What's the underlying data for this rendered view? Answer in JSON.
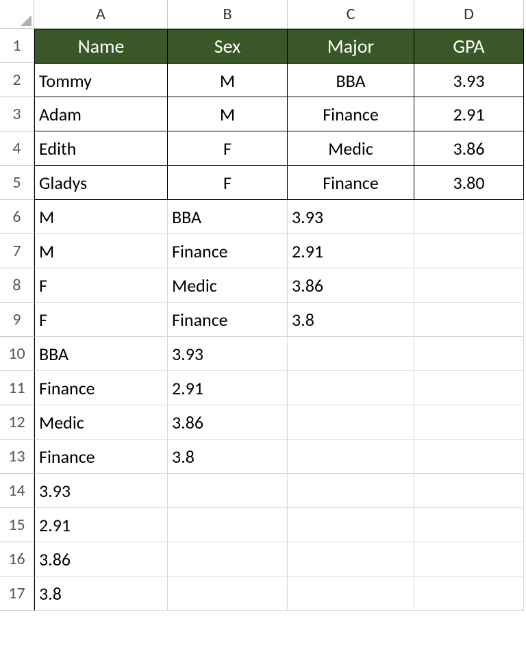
{
  "columns": [
    "A",
    "B",
    "C",
    "D"
  ],
  "rowNumbers": [
    "1",
    "2",
    "3",
    "4",
    "5",
    "6",
    "7",
    "8",
    "9",
    "10",
    "11",
    "12",
    "13",
    "14",
    "15",
    "16",
    "17"
  ],
  "header": {
    "name": "Name",
    "sex": "Sex",
    "major": "Major",
    "gpa": "GPA"
  },
  "data": [
    {
      "name": "Tommy",
      "sex": "M",
      "major": "BBA",
      "gpa": "3.93"
    },
    {
      "name": "Adam",
      "sex": "M",
      "major": "Finance",
      "gpa": "2.91"
    },
    {
      "name": "Edith",
      "sex": "F",
      "major": "Medic",
      "gpa": "3.86"
    },
    {
      "name": "Gladys",
      "sex": "F",
      "major": "Finance",
      "gpa": "3.80"
    }
  ],
  "rows6to9": [
    {
      "a": "M",
      "b": "BBA",
      "c": "3.93"
    },
    {
      "a": "M",
      "b": "Finance",
      "c": "2.91"
    },
    {
      "a": "F",
      "b": "Medic",
      "c": "3.86"
    },
    {
      "a": "F",
      "b": "Finance",
      "c": "3.8"
    }
  ],
  "rows10to13": [
    {
      "a": "BBA",
      "b": "3.93"
    },
    {
      "a": "Finance",
      "b": "2.91"
    },
    {
      "a": "Medic",
      "b": "3.86"
    },
    {
      "a": "Finance",
      "b": "3.8"
    }
  ],
  "rows14to17": [
    {
      "a": "3.93"
    },
    {
      "a": "2.91"
    },
    {
      "a": "3.86"
    },
    {
      "a": "3.8"
    }
  ]
}
